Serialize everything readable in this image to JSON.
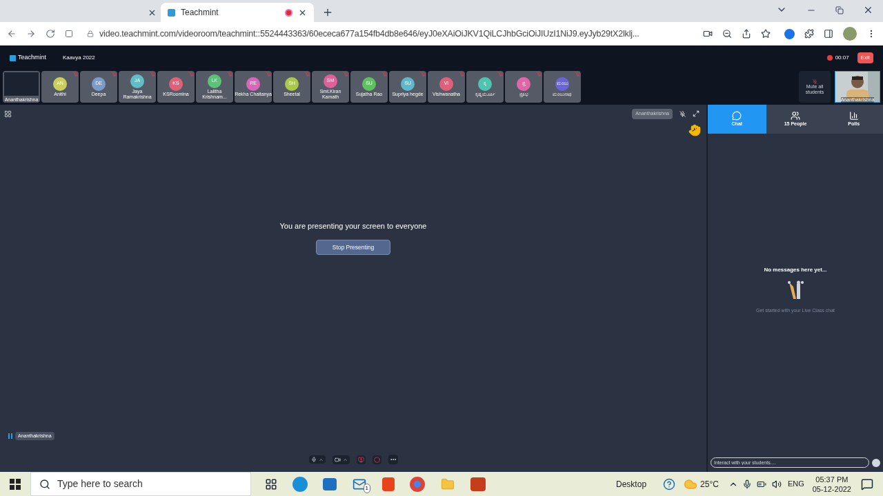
{
  "browser": {
    "tabs": [
      {
        "title": "Teachmint",
        "selected": true,
        "recording": true
      }
    ],
    "url": "video.teachmint.com/videoroom/teachmint::5524443363/60ececa677a154fb4db8e646/eyJ0eXAiOiJKV1QiLCJhbGciOiJIUzI1NiJ9.eyJyb29tX2lklj..."
  },
  "header": {
    "brand": "Teachmint",
    "class_name": "Kaavya 2022",
    "timer": "00:07",
    "exit": "Exit"
  },
  "participants": [
    {
      "kind": "screen",
      "name": "Ananthakrishna"
    },
    {
      "kind": "avatar",
      "initials": "AN",
      "name": "Anithi",
      "color": "#c9cf5a"
    },
    {
      "kind": "avatar",
      "initials": "DE",
      "name": "Deepa",
      "color": "#7b9cc9"
    },
    {
      "kind": "avatar",
      "initials": "JA",
      "name": "Jaya Ramakrishna",
      "color": "#5fbfc4"
    },
    {
      "kind": "avatar",
      "initials": "KS",
      "name": "KSRoomina",
      "color": "#e0607a"
    },
    {
      "kind": "avatar",
      "initials": "LK",
      "name": "Lalitha Krishnam...",
      "color": "#5cc27a"
    },
    {
      "kind": "avatar",
      "initials": "RE",
      "name": "Rekha Chaitanya",
      "color": "#d966b8"
    },
    {
      "kind": "avatar",
      "initials": "SH",
      "name": "Sheetal",
      "color": "#a8c94a"
    },
    {
      "kind": "avatar",
      "initials": "SM",
      "name": "Smt.Kiran Kamath",
      "color": "#e0609a"
    },
    {
      "kind": "avatar",
      "initials": "SU",
      "name": "Sujatha Rao",
      "color": "#5cc25f"
    },
    {
      "kind": "avatar",
      "initials": "SU",
      "name": "Supriya hegde",
      "color": "#5fb8c9"
    },
    {
      "kind": "avatar",
      "initials": "VI",
      "name": "Vishwanatha",
      "color": "#e0607a"
    },
    {
      "kind": "avatar",
      "initials": "ಕೃ",
      "name": "ಕೃಷ್ಣಮೂರ್ತಿ",
      "color": "#4fc4b0"
    },
    {
      "kind": "avatar",
      "initials": "ಪ್ರ",
      "name": "ಪ್ರತಿಭ",
      "color": "#e066a8"
    },
    {
      "kind": "avatar",
      "initials": "ಮಂಜು",
      "name": "ಮಂಜುನಾಥ",
      "color": "#6b63d9"
    }
  ],
  "mute_all": "Mute all students",
  "self_view": {
    "name": "Ananthakrishna"
  },
  "stage": {
    "presenter_tag": "Ananthakrishna",
    "message": "You are presenting your screen to everyone",
    "stop_button": "Stop Presenting",
    "speaker": "Ananthakrishna"
  },
  "panel": {
    "tabs": [
      {
        "label": "Chat",
        "selected": true
      },
      {
        "label": "15 People",
        "selected": false
      },
      {
        "label": "Polls",
        "selected": false
      }
    ],
    "empty_title": "No messages here yet...",
    "empty_hint": "Get started with your Live Class chat",
    "input_placeholder": "Interact with your students...."
  },
  "taskbar": {
    "search_placeholder": "Type here to search",
    "desktop": "Desktop",
    "temperature": "25°C",
    "language": "ENG",
    "time": "05:37 PM",
    "date": "05-12-2022",
    "mail_badge": "1"
  }
}
